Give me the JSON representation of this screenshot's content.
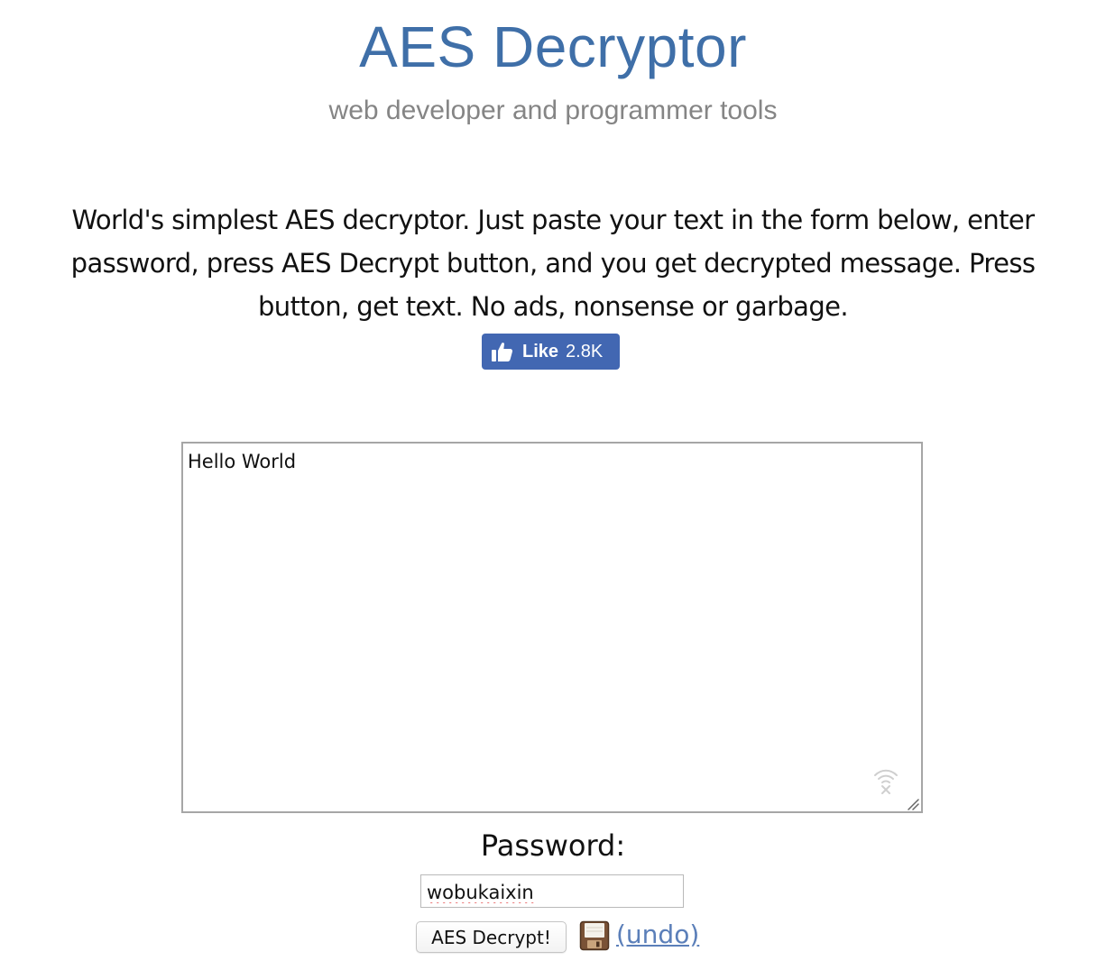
{
  "header": {
    "title": "AES Decryptor",
    "subtitle": "web developer and programmer tools"
  },
  "intro": {
    "description": "World's simplest AES decryptor. Just paste your text in the form below, enter password, press AES Decrypt button, and you get decrypted message. Press button, get text. No ads, nonsense or garbage."
  },
  "facebook": {
    "like_label": "Like",
    "like_count": "2.8K",
    "brand_color": "#4267b2"
  },
  "editor": {
    "text": "Hello World",
    "status_icon": "wifi-off-icon"
  },
  "form": {
    "password_label": "Password:",
    "password_value": "wobukaixin",
    "decrypt_button_label": "AES Decrypt!",
    "save_icon": "floppy-save-icon",
    "undo_label": "(undo)"
  },
  "colors": {
    "title": "#3f6fa8",
    "subtitle": "#858585",
    "link": "#5b7fb9"
  }
}
